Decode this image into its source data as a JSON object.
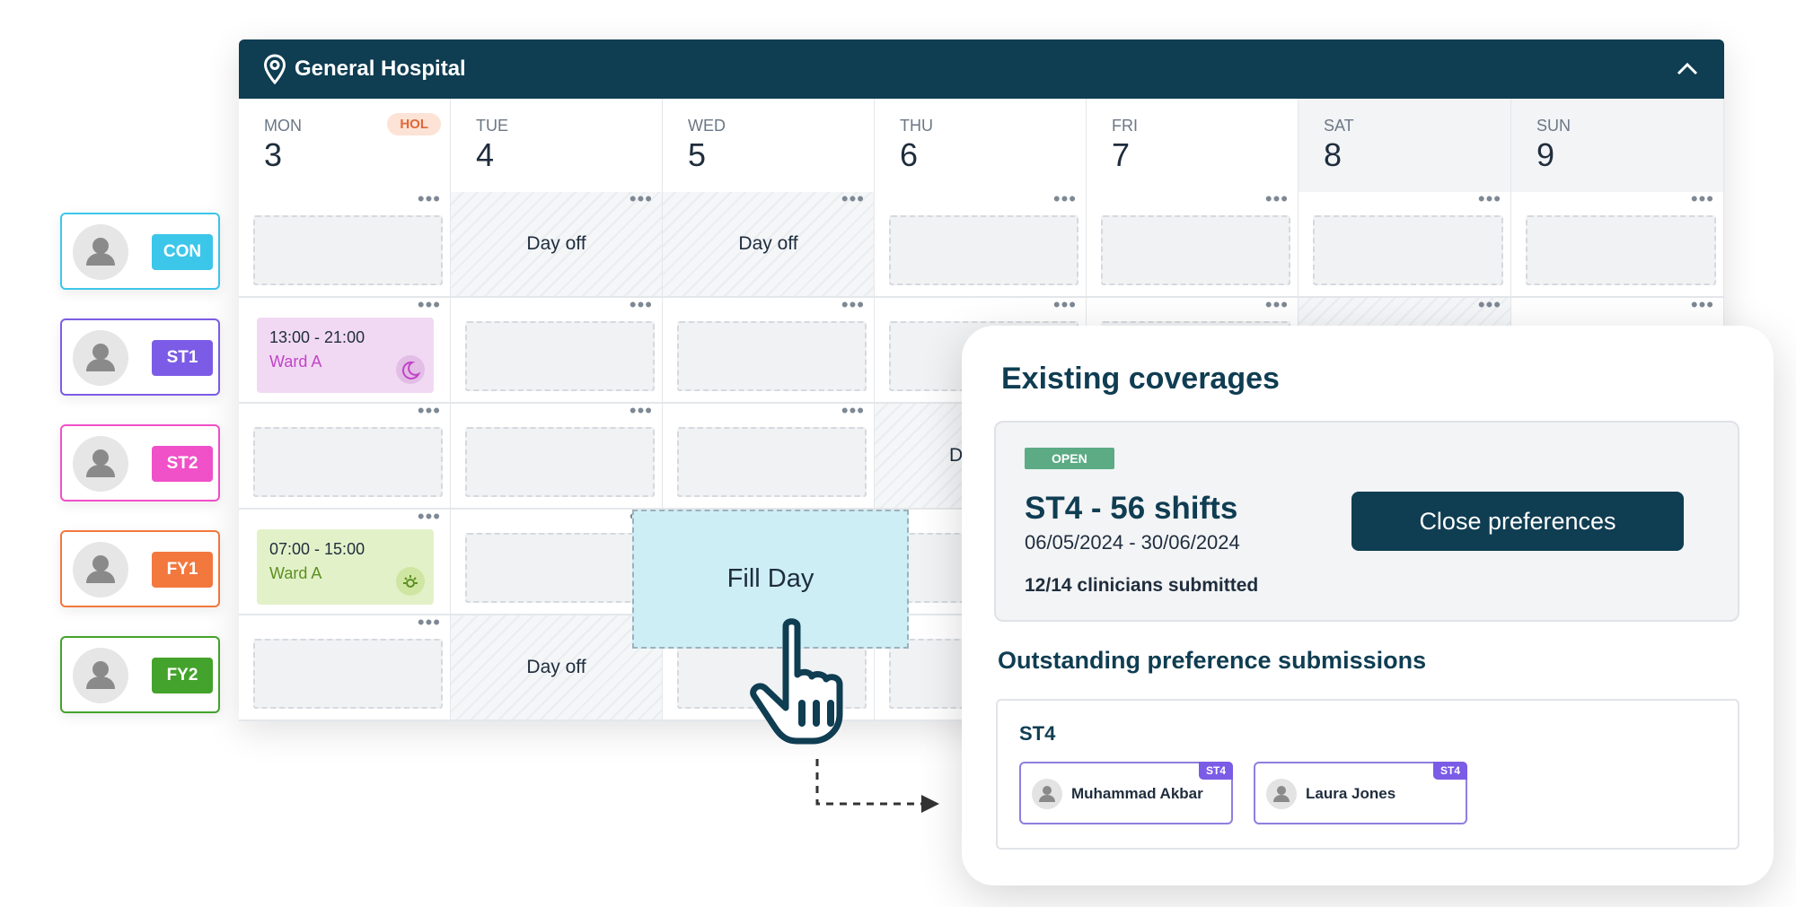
{
  "hospital": {
    "name": "General Hospital"
  },
  "days": [
    {
      "name": "MON",
      "num": "3"
    },
    {
      "name": "TUE",
      "num": "4"
    },
    {
      "name": "WED",
      "num": "5"
    },
    {
      "name": "THU",
      "num": "6"
    },
    {
      "name": "FRI",
      "num": "7"
    },
    {
      "name": "SAT",
      "num": "8"
    },
    {
      "name": "SUN",
      "num": "9"
    }
  ],
  "hol_label": "HOL",
  "roles": [
    {
      "label": "CON",
      "color": "#3cc7ea"
    },
    {
      "label": "ST1",
      "color": "#7c5ce6"
    },
    {
      "label": "ST2",
      "color": "#f050c8"
    },
    {
      "label": "FY1",
      "color": "#f3783e"
    },
    {
      "label": "FY2",
      "color": "#44a32c"
    }
  ],
  "day_off_label": "Day off",
  "shifts": {
    "st1_mon": {
      "time": "13:00 - 21:00",
      "ward": "Ward A",
      "bg": "#f1d9f3",
      "ward_color": "#c243c8",
      "icon": "moon-icon"
    },
    "fy1_mon": {
      "time": "07:00 - 15:00",
      "ward": "Ward A",
      "bg": "#e3f1c9",
      "ward_color": "#5b8f1f",
      "icon": "sun-icon"
    }
  },
  "row3_partial": "D",
  "fill_day_label": "Fill Day",
  "panel": {
    "title": "Existing coverages",
    "status": "OPEN",
    "coverage_title": "ST4 - 56 shifts",
    "dates": "06/05/2024 - 30/06/2024",
    "submitted": "12/14 clinicians submitted",
    "close_button": "Close preferences",
    "outstanding_title": "Outstanding preference submissions",
    "group": "ST4",
    "clinicians": [
      {
        "name": "Muhammad Akbar",
        "tag": "ST4"
      },
      {
        "name": "Laura Jones",
        "tag": "ST4"
      }
    ]
  }
}
